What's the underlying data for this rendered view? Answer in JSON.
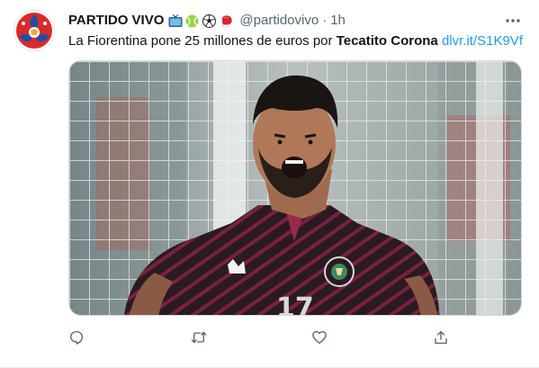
{
  "tweet": {
    "display_name": "PARTIDO VIVO",
    "name_emojis": [
      "tv-emoji",
      "tennis-ball-emoji",
      "soccer-ball-emoji",
      "boxing-glove-emoji"
    ],
    "handle": "@partidovivo",
    "separator": "·",
    "timestamp": "1h",
    "text_before": "La Fiorentina pone 25 millones de euros por ",
    "text_bold": "Tecatito Corona",
    "link_text": "dlvr.it/S1K9Vf",
    "image_label": "Football player in Mexico jersey celebrating",
    "jersey_number": "17"
  },
  "actions": [
    {
      "name": "reply",
      "icon": "reply-icon"
    },
    {
      "name": "retweet",
      "icon": "retweet-icon"
    },
    {
      "name": "like",
      "icon": "heart-icon"
    },
    {
      "name": "share",
      "icon": "share-icon"
    }
  ],
  "colors": {
    "text": "#0f1419",
    "secondary": "#536471",
    "link": "#1d9bf0",
    "icon": "#536471",
    "jersey": "#2a1a22",
    "jersey_stripe": "#a8284f"
  }
}
